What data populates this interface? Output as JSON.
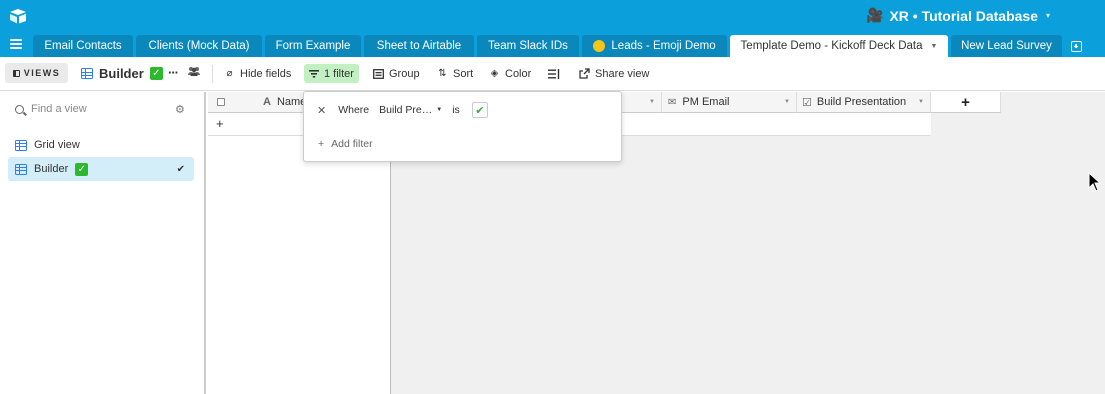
{
  "header": {
    "base_emoji": "🎥",
    "base_title": "XR • Tutorial Database",
    "base_caret": "▾"
  },
  "tabs": [
    {
      "label": "Email Contacts"
    },
    {
      "label": "Clients (Mock Data)"
    },
    {
      "label": "Form Example"
    },
    {
      "label": "Sheet to Airtable"
    },
    {
      "label": "Team Slack IDs"
    },
    {
      "label": "Leads - Emoji Demo"
    },
    {
      "label": "Template Demo - Kickoff Deck Data",
      "active": true
    },
    {
      "label": "New Lead Survey"
    }
  ],
  "toolbar": {
    "views_label": "VIEWS",
    "view_name": "Builder",
    "more": "···",
    "hide_fields": "Hide fields",
    "filter": "1 filter",
    "group": "Group",
    "sort": "Sort",
    "color": "Color",
    "share_view": "Share view"
  },
  "sidebar": {
    "search_placeholder": "Find a view",
    "views": [
      {
        "label": "Grid view",
        "active": false
      },
      {
        "label": "Builder",
        "active": true
      }
    ]
  },
  "grid": {
    "columns": [
      {
        "label": "Name",
        "icon": "A"
      },
      {
        "label": "PM Email",
        "icon": "✉"
      },
      {
        "label": "Build Presentation",
        "icon": "☑"
      }
    ],
    "add_row": "+",
    "add_column": "+"
  },
  "filter_popover": {
    "remove": "✕",
    "where": "Where",
    "field": "Build Pre…",
    "operator": "is",
    "value_checked": "✔",
    "add_filter": "Add filter"
  },
  "colors": {
    "header_bg": "#0b9fdb",
    "tab_bg": "#0a88bb",
    "filter_active": "#c3f0c2",
    "view_selected": "#d3eef9",
    "check_green": "#2eb82e"
  }
}
